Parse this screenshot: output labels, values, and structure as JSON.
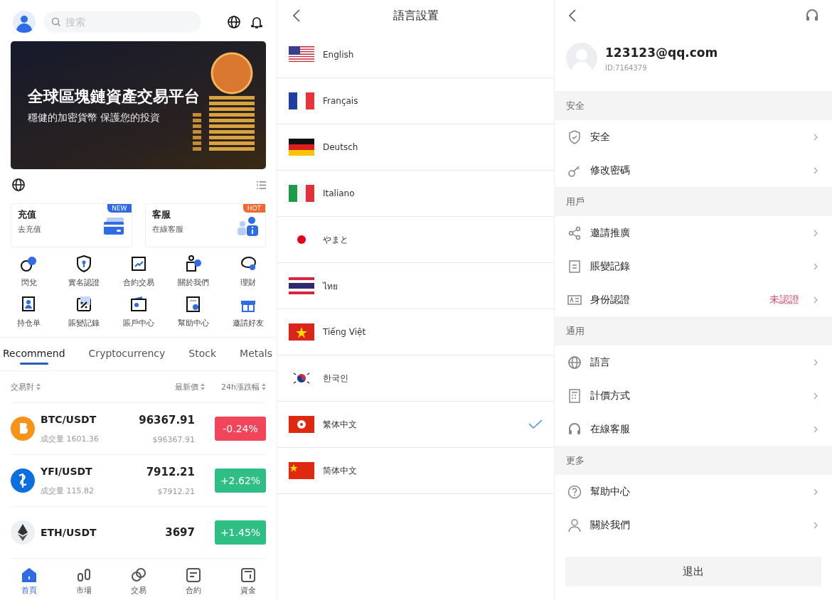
{
  "home": {
    "search": {
      "placeholder": "搜索"
    },
    "banner": {
      "title": "全球區塊鏈資產交易平台",
      "subtitle": "穩健的加密貨幣 保護您的投資"
    },
    "promo_cards": [
      {
        "title": "充值",
        "subtitle": "去充值",
        "badge": "NEW",
        "color": "#2e6be6"
      },
      {
        "title": "客服",
        "subtitle": "在線客服",
        "badge": "HOT",
        "color": "#f0682e"
      }
    ],
    "shortcuts": [
      "閃兌",
      "實名認證",
      "合約交易",
      "關於我們",
      "理財",
      "持仓单",
      "賬變記錄",
      "賬戶中心",
      "幫助中心",
      "邀請好友"
    ],
    "tabs": [
      {
        "label": "Recommend",
        "selected": true
      },
      {
        "label": "Cryptocurrency",
        "selected": false
      },
      {
        "label": "Stock",
        "selected": false
      },
      {
        "label": "Metals",
        "selected": false
      }
    ],
    "table_header": [
      "交易對",
      "最新價",
      "24h漲跌幅"
    ],
    "rows": [
      {
        "pair": "BTC/USDT",
        "volume": "成交量 1601.36",
        "price": "96367.91",
        "price_usd": "$96367.91",
        "change": "-0.24%",
        "color": "#f0455b"
      },
      {
        "pair": "YFI/USDT",
        "volume": "成交量 115.82",
        "price": "7912.21",
        "price_usd": "$7912.21",
        "change": "+2.62%",
        "color": "#2fbf84"
      },
      {
        "pair": "ETH/USDT",
        "price": "3697",
        "change": "+1.45%",
        "color": "#2fbf84"
      }
    ],
    "bottom_nav": [
      {
        "label": "首頁",
        "selected": true
      },
      {
        "label": "市場",
        "selected": false
      },
      {
        "label": "交易",
        "selected": false
      },
      {
        "label": "合約",
        "selected": false
      },
      {
        "label": "資金",
        "selected": false
      }
    ]
  },
  "language": {
    "title": "語言設置",
    "languages": [
      {
        "name": "English",
        "selected": false
      },
      {
        "name": "Français",
        "selected": false
      },
      {
        "name": "Deutsch",
        "selected": false
      },
      {
        "name": "Italiano",
        "selected": false
      },
      {
        "name": "やまと",
        "selected": false
      },
      {
        "name": "ไทย",
        "selected": false
      },
      {
        "name": "Tiếng Việt",
        "selected": false
      },
      {
        "name": "한국인",
        "selected": false
      },
      {
        "name": "繁体中文",
        "selected": true
      },
      {
        "name": "简体中文",
        "selected": false
      }
    ]
  },
  "profile": {
    "email": "123123@qq.com",
    "id": "ID:7164379",
    "sections": [
      {
        "title": "安全",
        "items": [
          {
            "label": "安全"
          },
          {
            "label": "修改密碼"
          }
        ]
      },
      {
        "title": "用戶",
        "items": [
          {
            "label": "邀請推廣"
          },
          {
            "label": "賬變記錄"
          },
          {
            "label": "身份認證",
            "status": "未認證"
          }
        ]
      },
      {
        "title": "通用",
        "items": [
          {
            "label": "語言"
          },
          {
            "label": "計價方式"
          },
          {
            "label": "在線客服"
          }
        ]
      },
      {
        "title": "更多",
        "items": [
          {
            "label": "幫助中心"
          },
          {
            "label": "關於我們"
          }
        ]
      }
    ],
    "logout": "退出"
  }
}
